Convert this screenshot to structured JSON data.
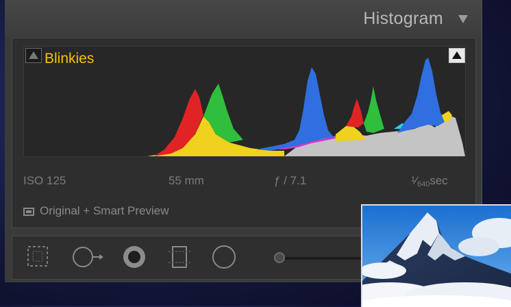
{
  "header": {
    "title": "Histogram"
  },
  "histogram": {
    "blinkies_label": "Blinkies",
    "shadow_clipping": "off",
    "highlight_clipping": "on",
    "colors": {
      "red": "#e02424",
      "green": "#2fbf3c",
      "blue": "#2f6fe0",
      "yellow": "#f0d21e",
      "gray": "#c4c4c4",
      "magenta": "#d13ad1",
      "cyan": "#2bd6e0"
    }
  },
  "exif": {
    "iso": "ISO 125",
    "focal_length": "55 mm",
    "aperture": "ƒ / 7.1",
    "shutter_num": "1",
    "shutter_den": "640",
    "shutter_unit": "sec"
  },
  "preview": {
    "label": "Original + Smart Preview"
  },
  "toolbar": {
    "tools": [
      "crop-overlay-icon",
      "spot-removal-icon",
      "red-eye-icon",
      "graduated-filter-icon",
      "radial-filter-icon",
      "brush-size-slider"
    ]
  },
  "thumbnail": {
    "subject": "snow-mountain-image"
  }
}
